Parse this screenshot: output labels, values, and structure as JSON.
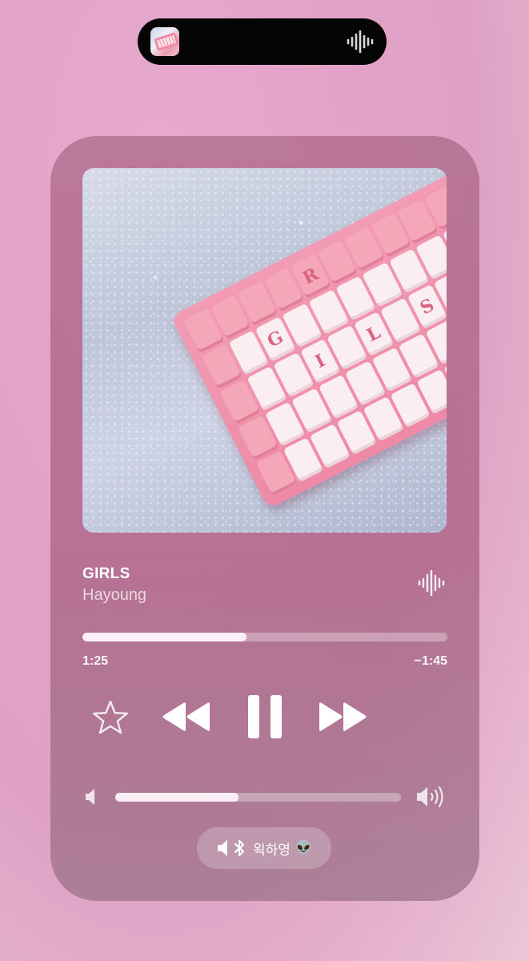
{
  "track": {
    "title": "GIRLS",
    "artist": "Hayoung",
    "artwork_keycaps": [
      "G",
      "I",
      "R",
      "L",
      "S"
    ]
  },
  "playback": {
    "elapsed": "1:25",
    "remaining": "−1:45",
    "progress_fraction": 0.45,
    "state": "playing"
  },
  "volume": {
    "level_fraction": 0.43
  },
  "output": {
    "device_name": "왹하영",
    "emoji": "👽",
    "icons": [
      "speaker-icon",
      "bluetooth-icon"
    ]
  },
  "controls": {
    "icons": [
      "star-icon",
      "rewind-icon",
      "pause-icon",
      "fast-forward-icon"
    ]
  },
  "island": {
    "icons": [
      "album-thumbnail",
      "waveform-icon"
    ]
  },
  "colors": {
    "background": "#e3a3c8",
    "card": "#a55e80",
    "progress_fill": "#fbeff5"
  }
}
